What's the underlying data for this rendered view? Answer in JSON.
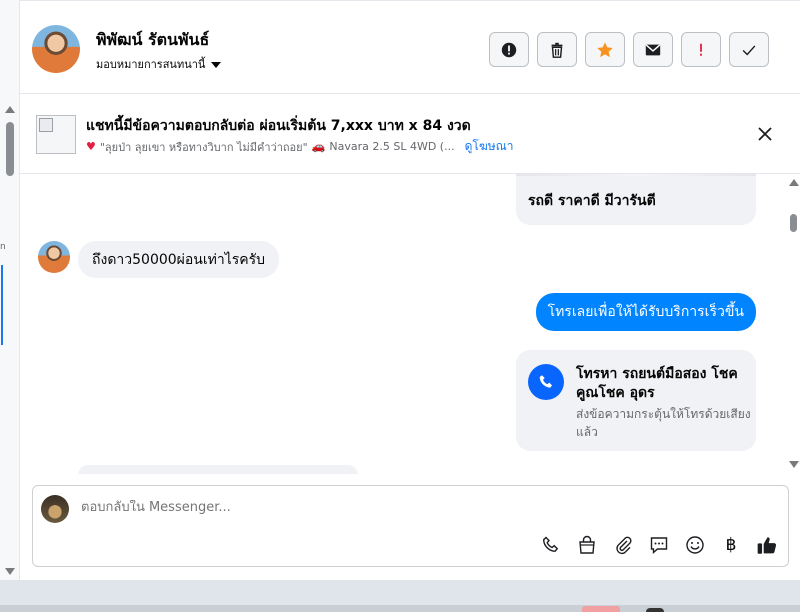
{
  "header": {
    "name": "พิพัฒน์ รัตนพันธ์",
    "assign_label": "มอบหมายการสนทนานี้",
    "actions": [
      {
        "name": "report-icon"
      },
      {
        "name": "trash-icon"
      },
      {
        "name": "star-icon",
        "color": "#f7931e"
      },
      {
        "name": "mail-icon"
      },
      {
        "name": "exclamation-icon",
        "color": "#e41e3f"
      },
      {
        "name": "check-icon"
      }
    ]
  },
  "banner": {
    "title": "แชทนี้มีข้อความตอบกลับต่อ ผ่อนเริ่มต้น 7,xxx บาท x 84 งวด",
    "description": "\"ลุยป่า ลุยเขา หรือทางวิบาก ไม่มีคำว่าถอย\"",
    "description_2": "Navara 2.5 SL 4WD (...",
    "see_ads": "ดูโฆษณา"
  },
  "messages": {
    "card_top_text": "รถดี ราคาดี มีวารันตี",
    "incoming_1": "ถึงดาว50000ผ่อนเท่าไรครับ",
    "outgoing_1": "โทรเลยเพื่อให้ได้รับบริการเร็วขึ้น",
    "call_card_title": "โทรหา รถยนต์มือสอง โชคคูณโชค อุดร",
    "call_card_desc": "ส่งข้อความกระตุ้นให้โทรด้วยเสียงแล้ว"
  },
  "composer": {
    "placeholder": "ตอบกลับใน Messenger...",
    "baht_symbol": "฿"
  },
  "sidebar": {
    "tiny_char": "n"
  },
  "colors": {
    "accent": "#0084ff",
    "call_blue": "#0866ff",
    "bubble_gray": "#f0f2f5",
    "link": "#1877f2"
  }
}
